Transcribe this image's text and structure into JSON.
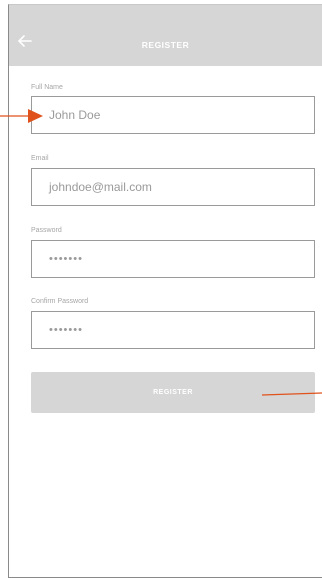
{
  "header": {
    "title": "REGISTER",
    "back_icon": "arrow-left-icon"
  },
  "form": {
    "full_name": {
      "label": "Full Name",
      "value": "John Doe"
    },
    "email": {
      "label": "Email",
      "value": "johndoe@mail.com"
    },
    "password": {
      "label": "Password",
      "value": "•••••••"
    },
    "confirm_password": {
      "label": "Confirm Password",
      "value": "•••••••"
    }
  },
  "register_button": {
    "label": "REGISTER"
  },
  "colors": {
    "header_bg": "#d6d6d6",
    "button_bg": "#d6d6d6",
    "annotation": "#e0521c",
    "text_muted": "#9a9a9a"
  }
}
